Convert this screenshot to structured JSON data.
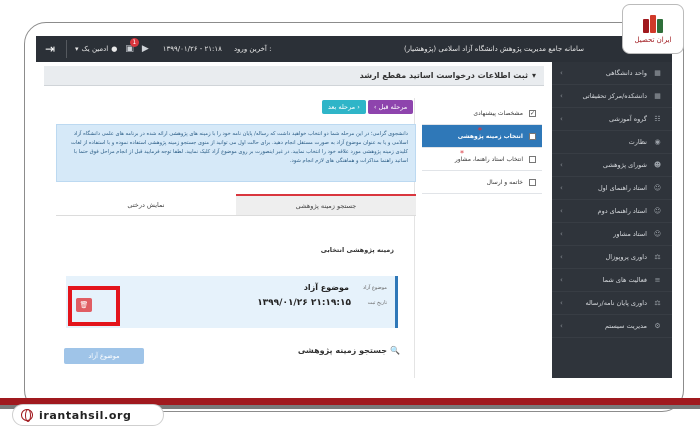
{
  "brand": {
    "site": "irantahsil.org",
    "logo_text": "ایران تحصیل"
  },
  "topbar": {
    "user": "ادمین یک",
    "badge_count": "1",
    "last_login_label": "آخرین ورود :",
    "last_login_value": "۱۳۹۹/۰۱/۲۶ - ۲۱:۱۸",
    "system_title": "سامانه جامع مدیریت پژوهش دانشگاه آزاد اسلامی (پژوهشیار)"
  },
  "sidebar": {
    "items": [
      {
        "label": "واحد دانشگاهی",
        "icon": "building-icon"
      },
      {
        "label": "دانشکده/مرکز تحقیقاتی",
        "icon": "building-icon"
      },
      {
        "label": "گروه آموزشی",
        "icon": "group-icon"
      },
      {
        "label": "نظارت",
        "icon": "eye-icon"
      },
      {
        "label": "شورای پژوهشی",
        "icon": "users-icon"
      },
      {
        "label": "استاد راهنمای اول",
        "icon": "user-icon"
      },
      {
        "label": "استاد راهنمای دوم",
        "icon": "user-icon"
      },
      {
        "label": "استاد مشاور",
        "icon": "user-icon"
      },
      {
        "label": "داوری پروپوزال",
        "icon": "gavel-icon"
      },
      {
        "label": "فعالیت های شما",
        "icon": "list-icon"
      },
      {
        "label": "داوری پایان نامه/رساله",
        "icon": "gavel-icon"
      },
      {
        "label": "مدیریت سیستم",
        "icon": "gear-icon"
      }
    ]
  },
  "page": {
    "title": "ثبت اطلاعات درخواست اساتید مقطع ارشد"
  },
  "steps": [
    {
      "label": "مشخصات پیشنهادی",
      "checked": true
    },
    {
      "label": "انتخاب زمینه پژوهشی",
      "active": true
    },
    {
      "label": "انتخاب استاد راهنما، مشاور"
    },
    {
      "label": "خاتمه و ارسال"
    }
  ],
  "nav": {
    "prev": "مرحله قبل",
    "next": "مرحله بعد"
  },
  "info_text": "دانشجوی گرامی؛ در این مرحله شما دو انتخاب خواهید داشت که رساله/ پایان نامه خود را با زمینه های پژوهشی ارائه شده در برنامه های علمی دانشگاه آزاد اسلامی و یا به عنوان موضوع آزاد به صورت مستقل انجام دهید. برای حالت اول می توانید از منوی جستجو زمینه پژوهشی استفاده نموده و با استفاده از لغات کلیدی زمینه پژوهشی مورد علاقه خود را انتخاب نمایید. در غیر اینصورت بر روی موضوع آزاد کلیک نمایید. لطفا توجه فرمایید قبل از انجام مراحل فوق حتما با اساتید راهنما مذاکرات و هماهنگی های لازم انجام شود.",
  "tabs": {
    "search": "جستجو زمینه پژوهشی",
    "display": "نمایش درختی"
  },
  "selected": {
    "section_title": "زمینه پژوهشی انتخابی",
    "topic_small": "موضوع آزاد",
    "topic": "موضوع آزاد",
    "date_small": "تاریخ ثبت",
    "date": "۱۳۹۹/۰۱/۲۶ ۲۱:۱۹:۱۵"
  },
  "search": {
    "title": "جستجو زمینه پژوهشی",
    "free_topic_button": "موضوع آزاد"
  }
}
